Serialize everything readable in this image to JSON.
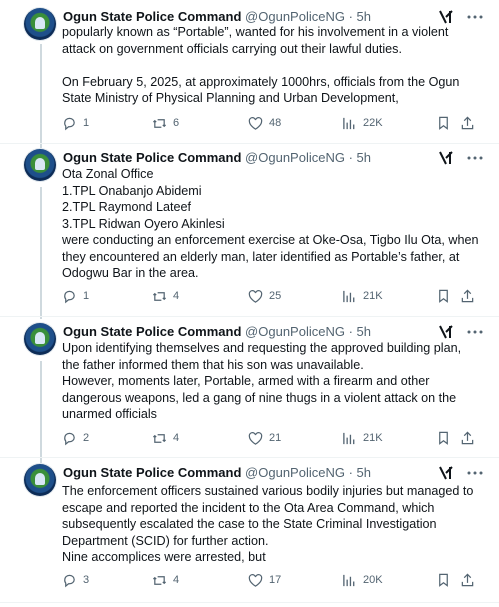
{
  "account": {
    "name": "Ogun State Police Command",
    "handle": "@OgunPoliceNG",
    "time": "5h"
  },
  "tweets": [
    {
      "body": "popularly known as “Portable”, wanted for his involvement in a violent attack on government officials carrying out their lawful duties.\n\nOn February 5, 2025, at approximately 1000hrs, officials from the Ogun State Ministry of Physical Planning and Urban Development,",
      "replies": "1",
      "reposts": "6",
      "likes": "48",
      "views": "22K"
    },
    {
      "body": "Ota Zonal Office\n1.TPL Onabanjo Abidemi\n2.TPL Raymond Lateef\n3.TPL Ridwan Oyero Akinlesi\nwere conducting an enforcement exercise at Oke-Osa, Tigbo Ilu Ota, when they encountered an elderly man, later identified as Portable’s father, at Odogwu Bar in the area.",
      "replies": "1",
      "reposts": "4",
      "likes": "25",
      "views": "21K"
    },
    {
      "body": "Upon identifying themselves and requesting the approved building plan, the father informed them that his son was unavailable.\nHowever, moments later, Portable, armed with a firearm and other dangerous weapons, led a gang of nine thugs in a violent attack on the unarmed officials",
      "replies": "2",
      "reposts": "4",
      "likes": "21",
      "views": "21K"
    },
    {
      "body": "The enforcement officers sustained various bodily injuries but managed to escape and reported the incident to the Ota Area Command, which subsequently escalated the case to the State Criminal Investigation Department (SCID) for further action.\nNine accomplices were arrested, but",
      "replies": "3",
      "reposts": "4",
      "likes": "17",
      "views": "20K"
    }
  ],
  "colors": {
    "text": "#0f1419",
    "muted": "#536471",
    "rail": "#cfd9de",
    "separator": "#eff3f4"
  }
}
